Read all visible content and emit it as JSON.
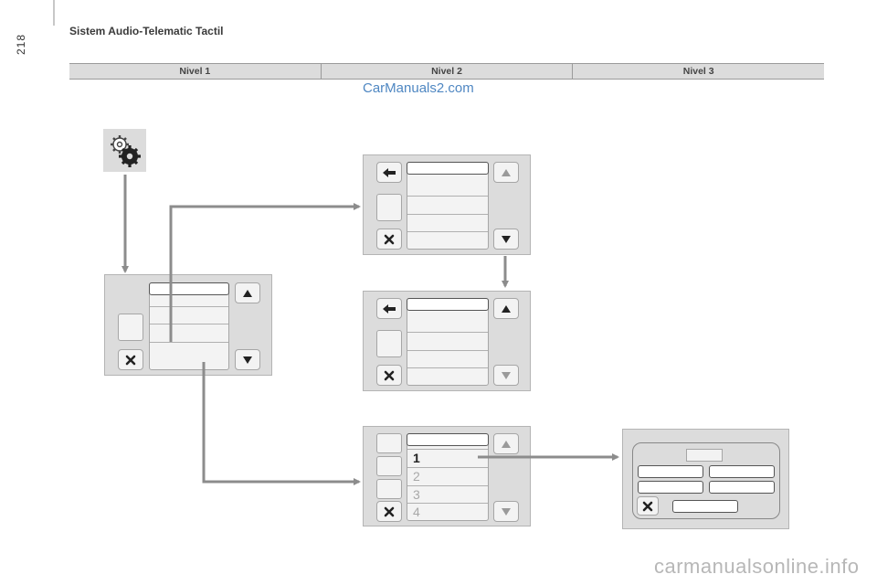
{
  "header": {
    "page_number": "218",
    "title": "Sistem Audio-Telematic Tactil"
  },
  "levels": [
    "Nivel 1",
    "Nivel 2",
    "Nivel 3"
  ],
  "watermarks": {
    "top": "CarManuals2.com",
    "bottom": "carmanualsonline.info"
  },
  "icons": {
    "settings": "gears-icon",
    "back": "back-arrow-icon",
    "close": "close-x-icon",
    "up": "triangle-up-icon",
    "down": "triangle-down-icon"
  },
  "preset_list": [
    "1",
    "2",
    "3",
    "4"
  ],
  "colors": {
    "panel_bg": "#dcdcdc",
    "button_bg": "#f3f3f3",
    "connector": "#8c8c8c",
    "watermark_top": "#4f87c2"
  }
}
